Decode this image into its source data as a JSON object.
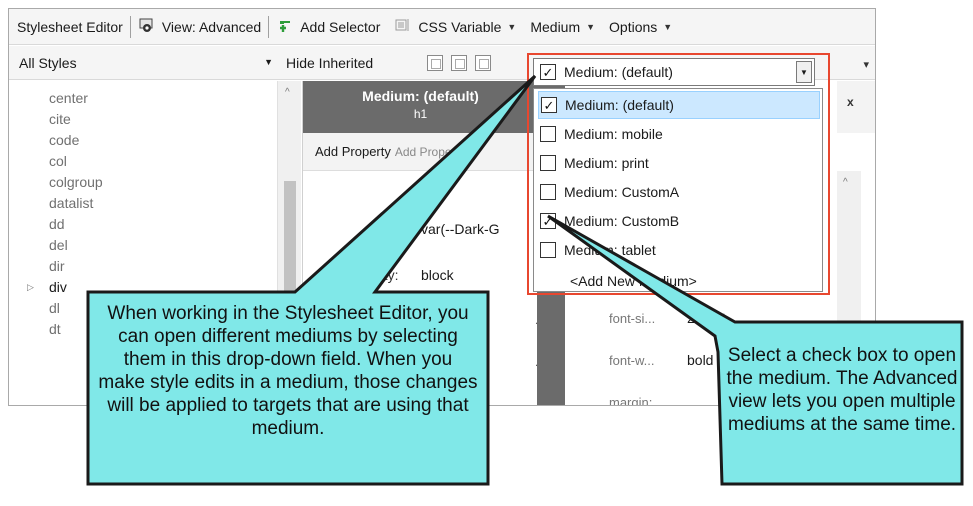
{
  "toolbar": {
    "title": "Stylesheet Editor",
    "view": "View: Advanced",
    "add_selector": "Add Selector",
    "css_variable": "CSS Variable",
    "medium": "Medium",
    "options": "Options"
  },
  "filter": {
    "all_styles": "All Styles",
    "hide_inherited": "Hide Inherited"
  },
  "style_list": [
    "center",
    "cite",
    "code",
    "col",
    "colgroup",
    "datalist",
    "dd",
    "del",
    "dir",
    "div",
    "dl",
    "dt"
  ],
  "middle_panel": {
    "header_title": "Medium: (default)",
    "header_sub": "h1",
    "add_property": "Add Property",
    "add_property_ghost": "Add Property",
    "row1_value": "var(--Dark-G",
    "row2_label": "display:",
    "row2_value": "block",
    "dots": "..."
  },
  "right_panel": {
    "close": "x",
    "font_size_label": "font-si...",
    "font_size_value": "24.0pt",
    "font_weight_label": "font-w...",
    "font_weight_value": "bold",
    "margin_label": "margin:",
    "dots": "..."
  },
  "medium_combo": {
    "value": "Medium: (default)",
    "checked": true
  },
  "medium_options": [
    {
      "label": "Medium: (default)",
      "checked": true,
      "selected": true
    },
    {
      "label": "Medium: mobile",
      "checked": false,
      "selected": false
    },
    {
      "label": "Medium: print",
      "checked": false,
      "selected": false
    },
    {
      "label": "Medium: CustomA",
      "checked": false,
      "selected": false
    },
    {
      "label": "Medium: CustomB",
      "checked": true,
      "selected": false
    },
    {
      "label": "Medium: tablet",
      "checked": false,
      "selected": false
    }
  ],
  "add_new_medium": "<Add New Medium>",
  "callouts": {
    "left": "When working in the Stylesheet Editor, you can open different mediums by selecting them in this drop-down field. When you make style edits in a medium, those changes will be applied to targets that are using that medium.",
    "right": "Select a check box to open the medium. The Advanced view lets you open multiple mediums at the same time."
  },
  "colors": {
    "callout_fill": "#80e8e8",
    "highlight": "#e8472f",
    "panel_header": "#6b6b6b"
  }
}
